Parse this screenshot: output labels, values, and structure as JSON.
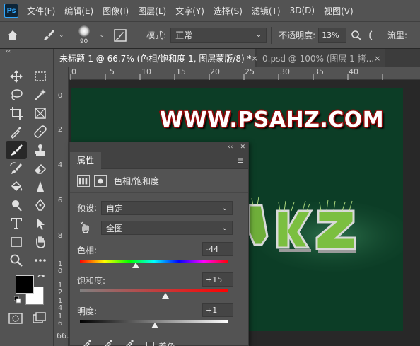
{
  "app": {
    "logo": "Ps"
  },
  "menu": [
    "文件(F)",
    "编辑(E)",
    "图像(I)",
    "图层(L)",
    "文字(Y)",
    "选择(S)",
    "滤镜(T)",
    "3D(D)",
    "视图(V)"
  ],
  "options_bar": {
    "brush_size": "90",
    "mode_label": "模式:",
    "mode_value": "正常",
    "opacity_label": "不透明度:",
    "opacity_value": "13%",
    "flow_label": "流里:"
  },
  "tabs": [
    {
      "label": "未标题-1 @ 66.7% (色相/饱和度 1, 图层蒙版/8) *",
      "close": "×"
    },
    {
      "label": "0.psd @ 100% (图层 1 拷...",
      "close": "×"
    }
  ],
  "ruler_top": [
    "0",
    "5",
    "10",
    "15",
    "20",
    "25",
    "30",
    "35",
    "40"
  ],
  "ruler_left": [
    [
      "0"
    ],
    [
      "2"
    ],
    [
      "4"
    ],
    [
      "6"
    ],
    [
      "8"
    ],
    [
      "1",
      "0"
    ],
    [
      "1",
      "2"
    ],
    [
      "1",
      "4"
    ],
    [
      "1",
      "6"
    ]
  ],
  "canvas": {
    "text": "WWW.PSAHZ.COM",
    "bg_color": "#0c3d26"
  },
  "status": {
    "zoom": "66."
  },
  "properties": {
    "title": "属性",
    "adjustment": "色相/饱和度",
    "preset_label": "预设:",
    "preset_value": "自定",
    "range_value": "全图",
    "hue_label": "色相:",
    "hue_value": "-44",
    "saturation_label": "饱和度:",
    "saturation_value": "+15",
    "lightness_label": "明度:",
    "lightness_value": "+1",
    "colorize_label": "着色",
    "hue_fraction": 0.378,
    "saturation_fraction": 0.575,
    "lightness_fraction": 0.505
  },
  "toolbar": {
    "collapse": "‹‹",
    "tools": [
      "move-icon",
      "marquee-icon",
      "lasso-icon",
      "magic-wand-icon",
      "crop-icon",
      "frame-icon",
      "eyedropper-icon",
      "healing-icon",
      "brush-icon",
      "stamp-icon",
      "history-brush-icon",
      "eraser-icon",
      "bucket-icon",
      "sharpen-icon",
      "dodge-icon",
      "pen-icon",
      "type-icon",
      "path-select-icon",
      "rectangle-icon",
      "hand-icon",
      "zoom-icon",
      "more-icon"
    ]
  }
}
